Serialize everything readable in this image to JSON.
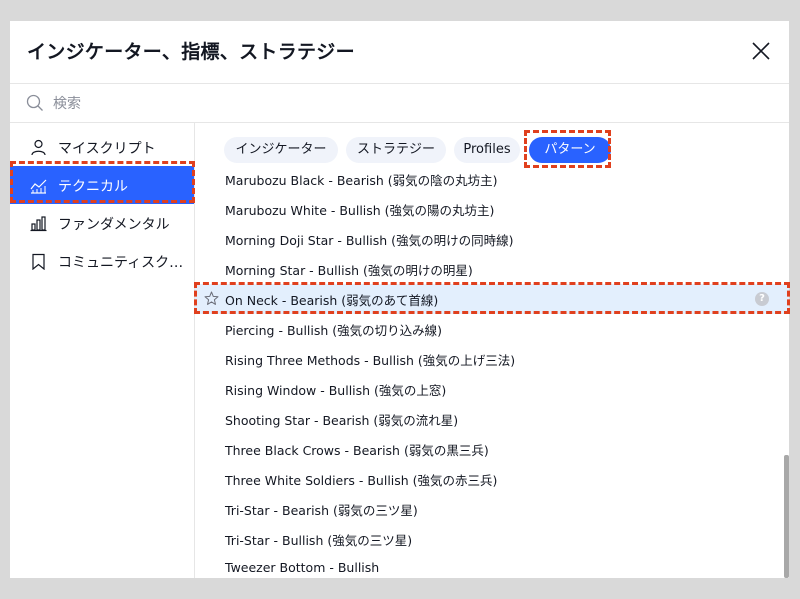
{
  "dialog": {
    "title": "インジケーター、指標、ストラテジー",
    "search_placeholder": "検索"
  },
  "sidebar": {
    "items": [
      {
        "label": "マイスクリプト",
        "icon": "user-icon"
      },
      {
        "label": "テクニカル",
        "icon": "chart-line-icon",
        "active": true
      },
      {
        "label": "ファンダメンタル",
        "icon": "bar-chart-icon"
      },
      {
        "label": "コミュニティスクリプト",
        "icon": "bookmark-icon"
      }
    ]
  },
  "tabs": [
    {
      "label": "インジケーター"
    },
    {
      "label": "ストラテジー"
    },
    {
      "label": "Profiles"
    },
    {
      "label": "パターン",
      "active": true
    }
  ],
  "patterns": [
    "Marubozu Black - Bearish (弱気の陰の丸坊主)",
    "Marubozu White - Bullish (強気の陽の丸坊主)",
    "Morning Doji Star - Bullish (強気の明けの同時線)",
    "Morning Star - Bullish (強気の明けの明星)",
    "On Neck - Bearish (弱気のあて首線)",
    "Piercing - Bullish (強気の切り込み線)",
    "Rising Three Methods - Bullish (強気の上げ三法)",
    "Rising Window - Bullish (強気の上窓)",
    "Shooting Star - Bearish (弱気の流れ星)",
    "Three Black Crows - Bearish (弱気の黒三兵)",
    "Three White Soldiers - Bullish (強気の赤三兵)",
    "Tri-Star - Bearish (弱気の三ツ星)",
    "Tri-Star - Bullish (強気の三ツ星)",
    "Tweezer Bottom - Bullish"
  ],
  "selected_pattern_index": 4,
  "help_glyph": "?",
  "colors": {
    "accent": "#2962ff",
    "highlight_border": "#e0401e",
    "selected_row": "#e3effd"
  }
}
